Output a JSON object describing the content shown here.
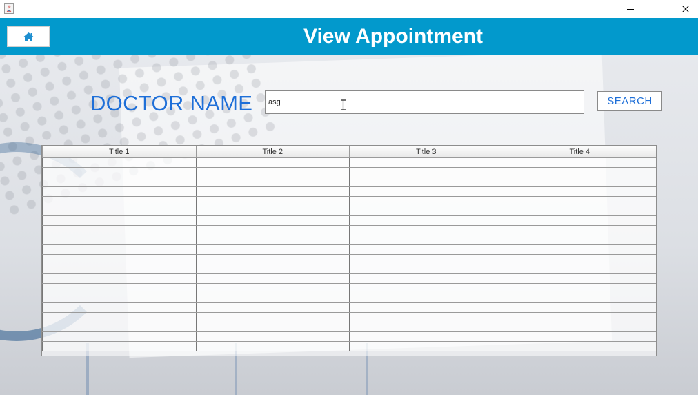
{
  "window": {
    "app_icon": "java-icon",
    "controls": {
      "minimize_icon": "minimize-icon",
      "maximize_icon": "maximize-icon",
      "close_icon": "close-icon"
    }
  },
  "header": {
    "title": "View Appointment",
    "home_icon": "home-icon",
    "color": "#0299cc"
  },
  "search": {
    "label": "DOCTOR NAME",
    "value": "asg",
    "button_label": "SEARCH",
    "accent_color": "#1e6fd8"
  },
  "table": {
    "columns": [
      "Title 1",
      "Title 2",
      "Title 3",
      "Title 4"
    ],
    "row_count": 20
  }
}
